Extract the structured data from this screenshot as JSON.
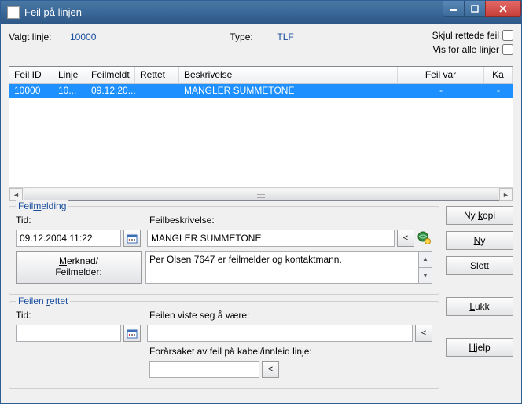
{
  "window": {
    "title": "Feil på linjen"
  },
  "header": {
    "valgt_linje_label": "Valgt linje:",
    "valgt_linje_value": "10000",
    "type_label": "Type:",
    "type_value": "TLF",
    "skjul_label": "Skjul rettede feil",
    "vis_alle_label": "Vis for alle linjer"
  },
  "grid": {
    "columns": {
      "feil_id": "Feil ID",
      "linje": "Linje",
      "feilmeldt": "Feilmeldt",
      "rettet": "Rettet",
      "beskrivelse": "Beskrivelse",
      "feil_var": "Feil var",
      "kabel": "Ka"
    },
    "rows": [
      {
        "feil_id": "10000",
        "linje": "10...",
        "feilmeldt": "09.12.20...",
        "rettet": "",
        "beskrivelse": "MANGLER SUMMETONE",
        "feil_var": "-",
        "kabel": "-"
      }
    ]
  },
  "feilmelding": {
    "legend": "Feilmelding",
    "tid_label": "Tid:",
    "tid_value": "09.12.2004 11:22",
    "feilbeskrivelse_label": "Feilbeskrivelse:",
    "feilbeskrivelse_value": "MANGLER SUMMETONE",
    "merknad_btn_l1": "Merknad/",
    "merknad_btn_l2": "Feilmelder:",
    "merknad_text": "Per Olsen 7647 er feilmelder og kontaktmann."
  },
  "rettet": {
    "legend": "Feilen rettet",
    "tid_label": "Tid:",
    "tid_value": "",
    "viste_label": "Feilen viste seg å være:",
    "viste_value": "",
    "forarsaket_label": "Forårsaket av feil på kabel/innleid linje:",
    "forarsaket_value": ""
  },
  "buttons": {
    "ny_kopi": "Ny kopi",
    "ny": "Ny",
    "slett": "Slett",
    "lukk": "Lukk",
    "hjelp": "Hjelp",
    "pick": "<"
  }
}
